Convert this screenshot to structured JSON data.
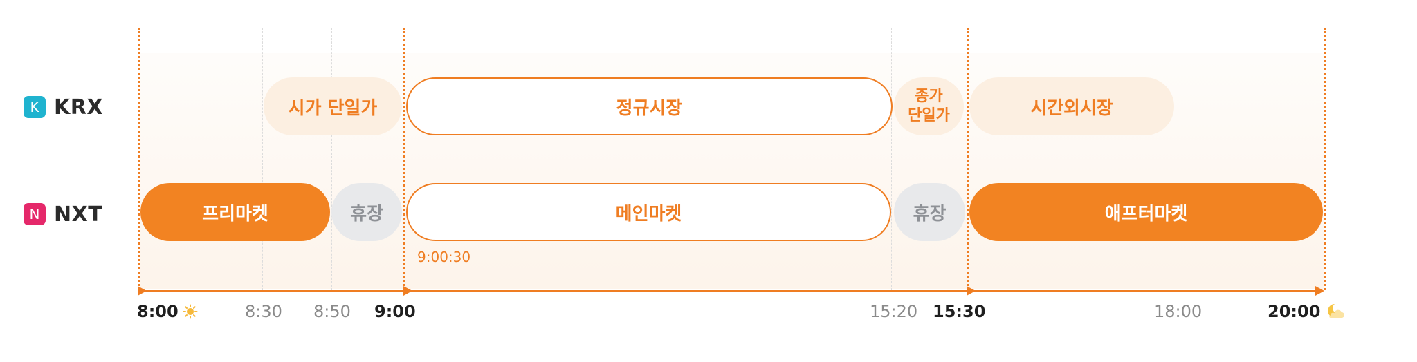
{
  "exchanges": [
    {
      "name": "KRX",
      "badge_letter": "K",
      "badge_color": "#1fb3cf"
    },
    {
      "name": "NXT",
      "badge_letter": "N",
      "badge_color": "#e5286a"
    }
  ],
  "sessions": {
    "krx": {
      "opening_auction": "시가 단일가",
      "regular": "정규시장",
      "closing_auction": "종가\n단일가",
      "after_hours": "시간외시장"
    },
    "nxt": {
      "pre_market": "프리마켓",
      "break_1": "휴장",
      "main_market": "메인마켓",
      "break_2": "휴장",
      "after_market": "애프터마켓"
    }
  },
  "main_market_start_note": "9:00:30",
  "timeline": {
    "ticks": [
      {
        "label": "8:00",
        "emphasis": true,
        "icon": "sun-icon"
      },
      {
        "label": "8:30",
        "emphasis": false
      },
      {
        "label": "8:50",
        "emphasis": false
      },
      {
        "label": "9:00",
        "emphasis": true
      },
      {
        "label": "15:20",
        "emphasis": false
      },
      {
        "label": "15:30",
        "emphasis": true
      },
      {
        "label": "18:00",
        "emphasis": false
      },
      {
        "label": "20:00",
        "emphasis": true,
        "icon": "moon-cloud-icon"
      }
    ]
  },
  "colors": {
    "accent": "#ef7d22",
    "accent_solid": "#f28322",
    "accent_light": "#fcefe1",
    "break_grey": "#e8e9eb",
    "krx_badge": "#1fb3cf",
    "nxt_badge": "#e5286a"
  }
}
